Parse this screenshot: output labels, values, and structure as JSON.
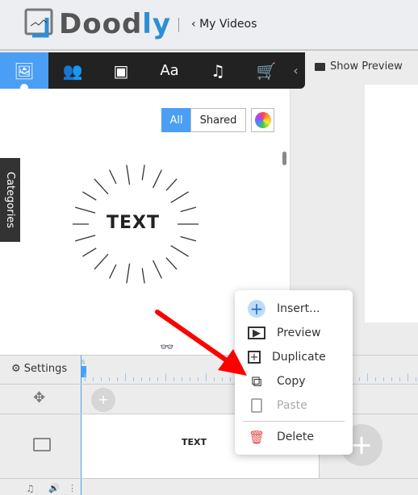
{
  "header": {
    "logo": "Doodly",
    "back_label": "My Videos"
  },
  "toolbar": {
    "tabs": [
      "image-icon",
      "characters-icon",
      "props-icon",
      "text-icon",
      "music-icon",
      "cart-icon"
    ],
    "active": 0,
    "collapse": "chevron-left-icon"
  },
  "preview": {
    "show_preview_label": "Show Preview"
  },
  "library": {
    "filter_all": "All",
    "filter_shared": "Shared",
    "categories_label": "Categories",
    "asset_text": "TEXT"
  },
  "timeline": {
    "settings_label": "Settings",
    "marker": "s",
    "clip_text": "TEXT"
  },
  "context_menu": {
    "items": [
      {
        "label": "Insert...",
        "icon": "plus-icon"
      },
      {
        "label": "Preview",
        "icon": "preview-icon"
      },
      {
        "label": "Duplicate",
        "icon": "duplicate-icon"
      },
      {
        "label": "Copy",
        "icon": "copy-icon"
      },
      {
        "label": "Paste",
        "icon": "paste-icon",
        "disabled": true
      },
      {
        "label": "Delete",
        "icon": "trash-icon"
      }
    ]
  },
  "colors": {
    "accent": "#4a9ff5",
    "toolbar": "#222222",
    "delete": "#e04b4b",
    "arrow": "#ff0000"
  }
}
